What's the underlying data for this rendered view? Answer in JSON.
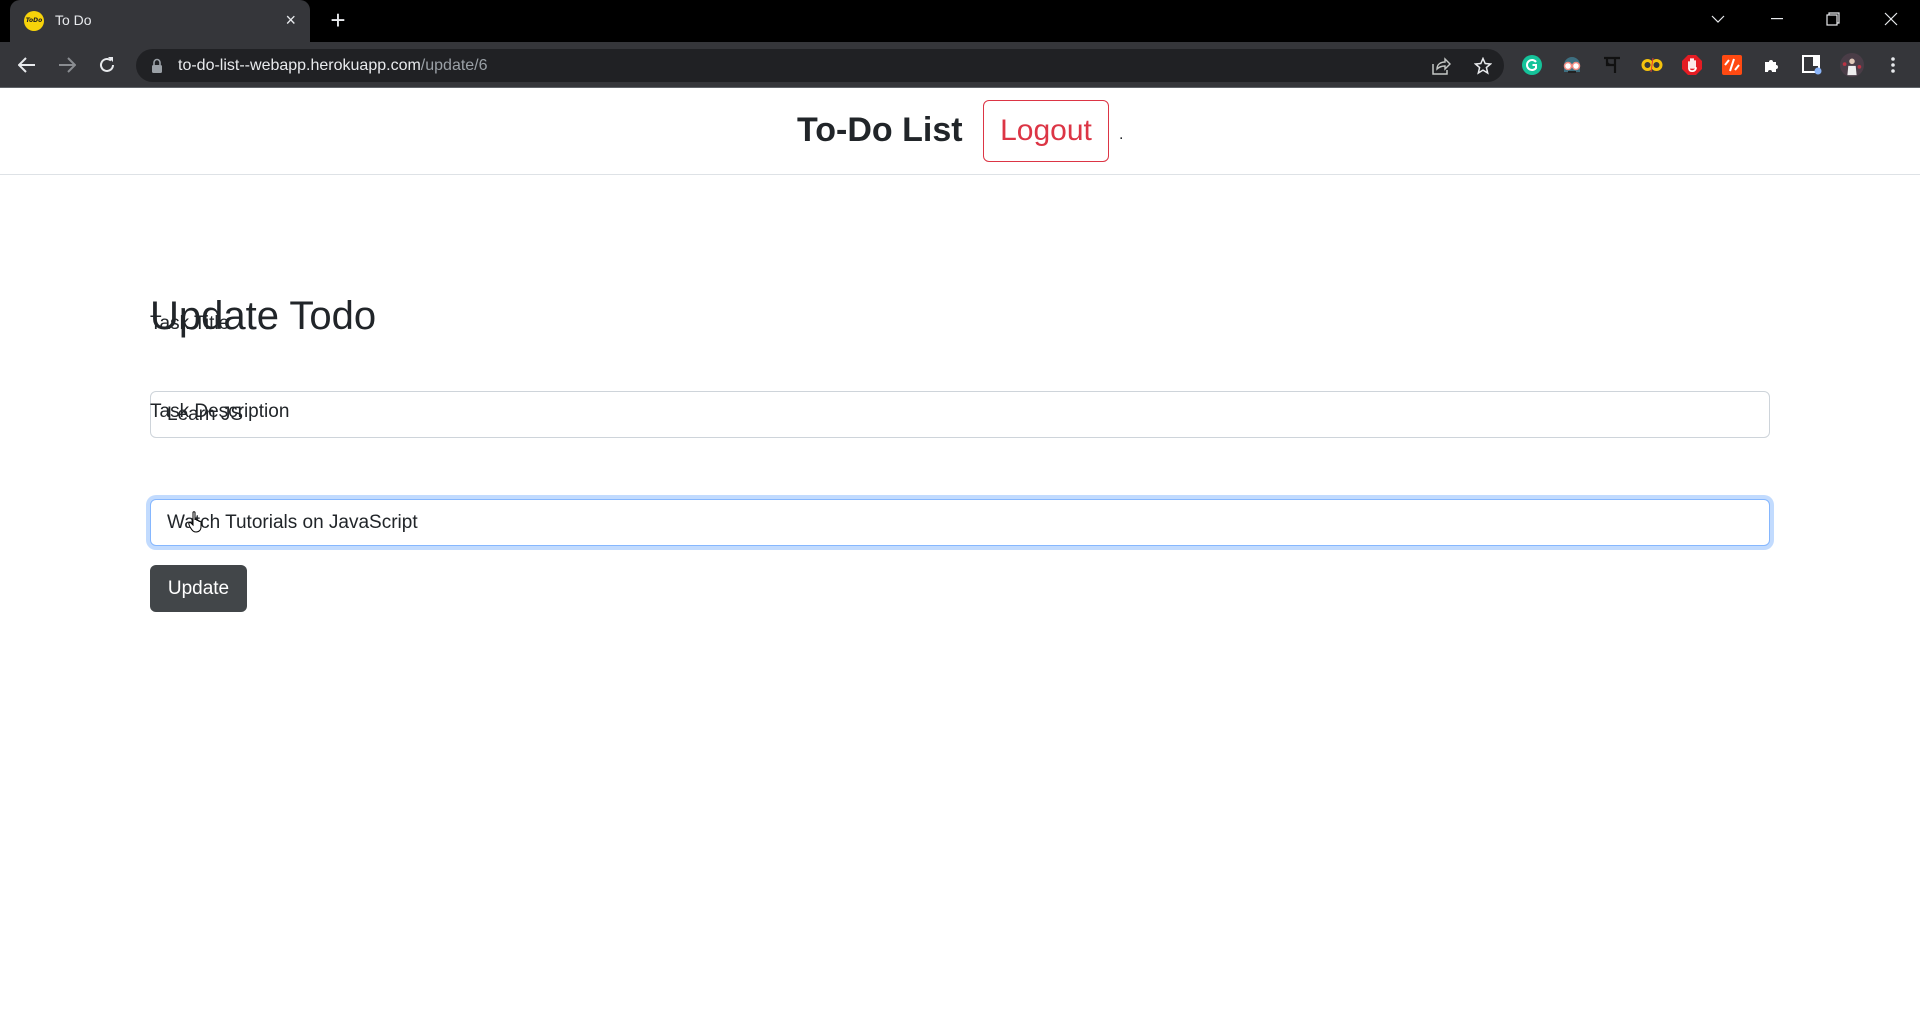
{
  "browser": {
    "tab": {
      "title": "To Do",
      "favicon_text": "ToDo",
      "close_glyph": "×"
    },
    "new_tab_glyph": "+",
    "url": {
      "host": "to-do-list--webapp.herokuapp.com",
      "path": "/update/6"
    },
    "extensions": [
      "grammarly-icon",
      "glasses-extension-icon",
      "devanagari-ma-icon",
      "infinity-extension-icon",
      "adblock-hand-icon",
      "code-extension-icon",
      "puzzle-extensions-icon",
      "side-panel-icon",
      "profile-avatar",
      "menu-kebab-icon"
    ],
    "colors": {
      "tabbar": "#000000",
      "toolbar": "#35363a",
      "omnibox": "#202124"
    }
  },
  "header": {
    "title": "To-Do List",
    "logout_label": "Logout",
    "trailing_text": "."
  },
  "form": {
    "heading": "Update Todo",
    "title_label": "Task Title",
    "title_value": "Learn JS",
    "description_label": "Task Description",
    "description_value": "Watch Tutorials on JavaScript",
    "submit_label": "Update"
  },
  "colors": {
    "logout": "#dc3545",
    "update_button": "#424649",
    "focus_ring": "#86b7fe"
  }
}
